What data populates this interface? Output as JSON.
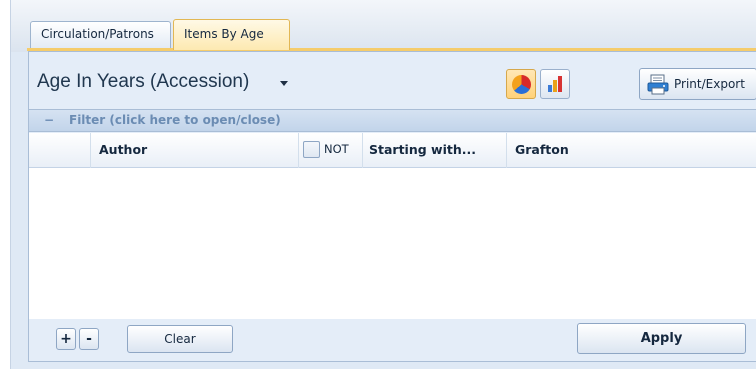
{
  "tabs": [
    {
      "label": "Circulation/Patrons",
      "active": false
    },
    {
      "label": "Items By Age",
      "active": true
    }
  ],
  "report": {
    "title": "Age In Years (Accession)"
  },
  "toolbar": {
    "pie_icon": "pie-chart-icon",
    "bar_icon": "bar-chart-icon",
    "print_label": "Print/Export"
  },
  "filter": {
    "toggle_symbol": "−",
    "label": "Filter (click here to open/close)",
    "columns": {
      "field": "Author",
      "not_label": "NOT",
      "operator": "Starting with...",
      "value": "Grafton"
    },
    "not_checked": false
  },
  "actions": {
    "add_label": "+",
    "remove_label": "-",
    "clear_label": "Clear",
    "apply_label": "Apply"
  },
  "colors": {
    "active_tab": "#fde9b1",
    "accent_line": "#f5cc6b",
    "filter_text": "#6b8cb3"
  }
}
